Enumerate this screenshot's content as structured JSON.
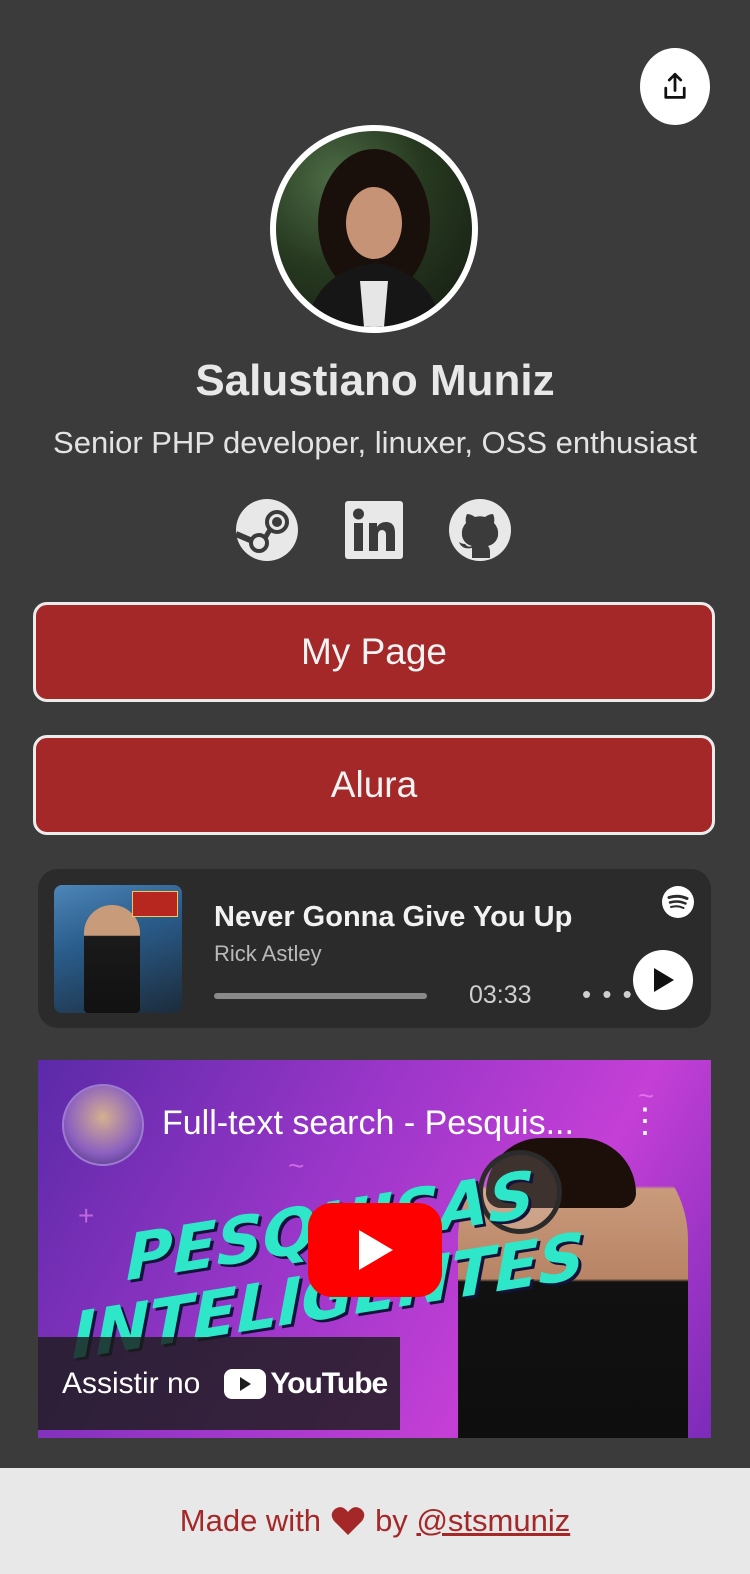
{
  "profile": {
    "name": "Salustiano Muniz",
    "bio": "Senior PHP developer, linuxer, OSS enthusiast"
  },
  "socials": [
    {
      "icon": "steam-icon"
    },
    {
      "icon": "linkedin-icon"
    },
    {
      "icon": "github-icon"
    }
  ],
  "links": [
    {
      "label": "My Page"
    },
    {
      "label": "Alura"
    }
  ],
  "spotify": {
    "title": "Never Gonna Give You Up",
    "artist": "Rick Astley",
    "duration": "03:33",
    "more": "• • •"
  },
  "youtube": {
    "title": "Full-text search - Pesquis...",
    "thumb_line1": "PESQUISAS",
    "thumb_line2": "INTELIGENTES",
    "watch_label": "Assistir no",
    "brand": "YouTube"
  },
  "footer": {
    "made_with": "Made with",
    "by": "by",
    "handle": "@stsmuniz"
  },
  "colors": {
    "background": "#3b3b3b",
    "button": "#a52829",
    "footer_bg": "#e8e8e8"
  }
}
